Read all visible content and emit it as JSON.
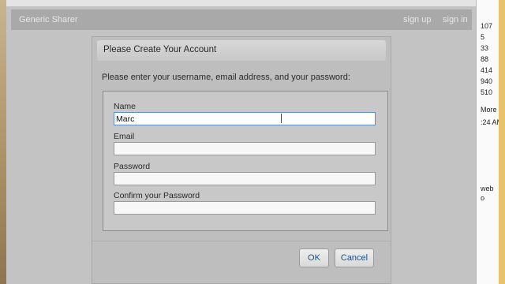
{
  "navbar": {
    "brand": "Generic Sharer",
    "sign_up": "sign up",
    "sign_in": "sign in"
  },
  "side_panel": {
    "items": [
      "107",
      "5",
      "33",
      "88",
      "414",
      "940",
      "510",
      "More ▾",
      ":24 AM",
      "web",
      "o"
    ]
  },
  "modal": {
    "title": "Please Create Your Account",
    "instructions": "Please enter your username, email address, and your password:",
    "fields": [
      {
        "label": "Name",
        "value": "Marc",
        "active": true
      },
      {
        "label": "Email",
        "value": ""
      },
      {
        "label": "Password",
        "value": ""
      },
      {
        "label": "Confirm your Password",
        "value": ""
      }
    ],
    "ok_label": "OK",
    "cancel_label": "Cancel"
  },
  "colors": {
    "link": "#1a4f87",
    "focus_border": "#5f8fc4",
    "overlay": "#c3c3c3"
  }
}
